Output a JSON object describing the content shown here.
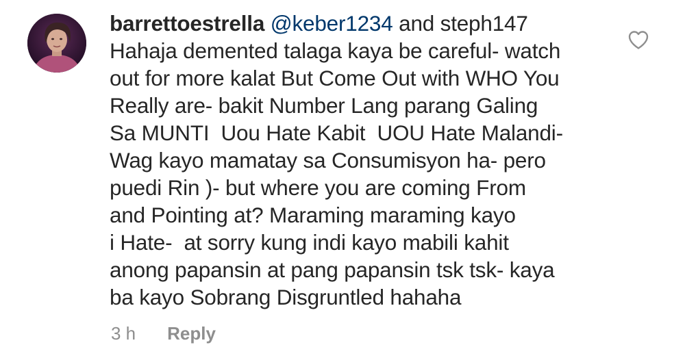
{
  "comment": {
    "username": "barrettoestrella",
    "mentions": [
      "@keber1234"
    ],
    "after_mention": " and steph147",
    "lines": [
      "Hahaja demented talaga kaya be careful- watch",
      "out for more kalat But Come Out with WHO You",
      "Really are- bakit Number Lang parang Galing",
      "Sa MUNTI  Uou Hate Kabit  UOU Hate Malandi-",
      "Wag kayo mamatay sa Consumisyon ha- pero",
      "puedi Rin )- but where you are coming From",
      "and Pointing at? Maraming maraming kayo",
      "i Hate-  at sorry kung indi kayo mabili kahit",
      "anong papansin at pang papansin tsk tsk- kaya",
      "ba kayo Sobrang Disgruntled hahaha"
    ],
    "time": "3 h",
    "reply_label": "Reply",
    "icons": {
      "like": "heart-outline-icon",
      "avatar": "profile-photo"
    },
    "colors": {
      "text": "#262626",
      "mention": "#00376b",
      "meta": "#8e8e8e"
    }
  }
}
